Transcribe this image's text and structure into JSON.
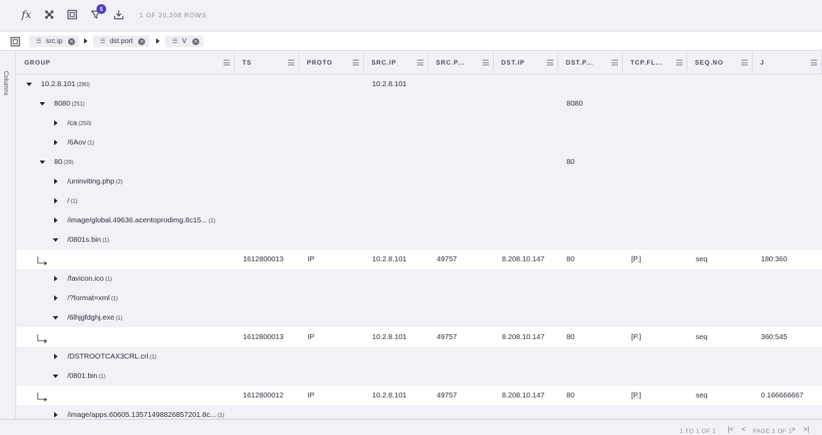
{
  "toolbar": {
    "icons": [
      "function-icon",
      "pivot-icon",
      "group-panel-icon",
      "filter-icon",
      "download-icon"
    ],
    "fx_label": "fx",
    "filter_badge": "5",
    "row_count": "1 OF 20,208 ROWS"
  },
  "group_bar": {
    "chips": [
      {
        "label": "src.ip"
      },
      {
        "label": "dst.port"
      },
      {
        "label": "V"
      }
    ]
  },
  "side_panel": {
    "columns_label": "Columns"
  },
  "columns": [
    "GROUP",
    "TS",
    "PROTO",
    "SRC.IP",
    "SRC.P...",
    "DST.IP",
    "DST.P...",
    "TCP.FL...",
    "SEQ.NO",
    "J"
  ],
  "rows": [
    {
      "type": "group",
      "level": 0,
      "open": true,
      "label": "10.2.8.101",
      "count": "(280)",
      "src_ip": "10.2.8.101",
      "dst_port": ""
    },
    {
      "type": "group",
      "level": 1,
      "open": true,
      "label": "8080",
      "count": "(251)",
      "src_ip": "",
      "dst_port": "8080"
    },
    {
      "type": "group",
      "level": 2,
      "open": false,
      "label": "/ca",
      "count": "(250)",
      "src_ip": "",
      "dst_port": ""
    },
    {
      "type": "group",
      "level": 2,
      "open": false,
      "label": "/6Aov",
      "count": "(1)",
      "src_ip": "",
      "dst_port": ""
    },
    {
      "type": "group",
      "level": 1,
      "open": true,
      "label": "80",
      "count": "(29)",
      "src_ip": "",
      "dst_port": "80"
    },
    {
      "type": "group",
      "level": 2,
      "open": false,
      "label": "/uninviting.php",
      "count": "(2)",
      "src_ip": "",
      "dst_port": ""
    },
    {
      "type": "group",
      "level": 2,
      "open": false,
      "label": "/",
      "count": "(1)",
      "src_ip": "",
      "dst_port": ""
    },
    {
      "type": "group",
      "level": 2,
      "open": false,
      "label": "/image/global.49636.acentoprodimg.8c15...",
      "count": "(1)",
      "src_ip": "",
      "dst_port": ""
    },
    {
      "type": "group",
      "level": 2,
      "open": true,
      "label": "/0801s.bin",
      "count": "(1)",
      "src_ip": "",
      "dst_port": ""
    },
    {
      "type": "leaf",
      "ts": "1612800013",
      "proto": "IP",
      "src_ip": "10.2.8.101",
      "src_port": "49757",
      "dst_ip": "8.208.10.147",
      "dst_port": "80",
      "tcp_flags": "[P.]",
      "seq_no": "seq",
      "j": "180:360"
    },
    {
      "type": "group",
      "level": 2,
      "open": false,
      "label": "/favicon.ico",
      "count": "(1)",
      "src_ip": "",
      "dst_port": ""
    },
    {
      "type": "group",
      "level": 2,
      "open": false,
      "label": "/?format=xml",
      "count": "(1)",
      "src_ip": "",
      "dst_port": ""
    },
    {
      "type": "group",
      "level": 2,
      "open": true,
      "label": "/6lhjgfdghj.exe",
      "count": "(1)",
      "src_ip": "",
      "dst_port": ""
    },
    {
      "type": "leaf",
      "ts": "1612800013",
      "proto": "IP",
      "src_ip": "10.2.8.101",
      "src_port": "49757",
      "dst_ip": "8.208.10.147",
      "dst_port": "80",
      "tcp_flags": "[P.]",
      "seq_no": "seq",
      "j": "360:545"
    },
    {
      "type": "group",
      "level": 2,
      "open": false,
      "label": "/DSTROOTCAX3CRL.crl",
      "count": "(1)",
      "src_ip": "",
      "dst_port": ""
    },
    {
      "type": "group",
      "level": 2,
      "open": true,
      "label": "/0801.bin",
      "count": "(1)",
      "src_ip": "",
      "dst_port": ""
    },
    {
      "type": "leaf",
      "ts": "1612800012",
      "proto": "IP",
      "src_ip": "10.2.8.101",
      "src_port": "49757",
      "dst_ip": "8.208.10.147",
      "dst_port": "80",
      "tcp_flags": "[P.]",
      "seq_no": "seq",
      "j": "0.166666667"
    },
    {
      "type": "group",
      "level": 2,
      "open": false,
      "label": "/image/apps.60605.13571498826857201.8c...",
      "count": "(1)",
      "src_ip": "",
      "dst_port": ""
    }
  ],
  "footer": {
    "range": "1 TO 1 OF 1",
    "page": "PAGE 1 OF 1",
    "nav": {
      "first": "|<",
      "prev": "<",
      "next": ">",
      "last": ">|"
    }
  }
}
